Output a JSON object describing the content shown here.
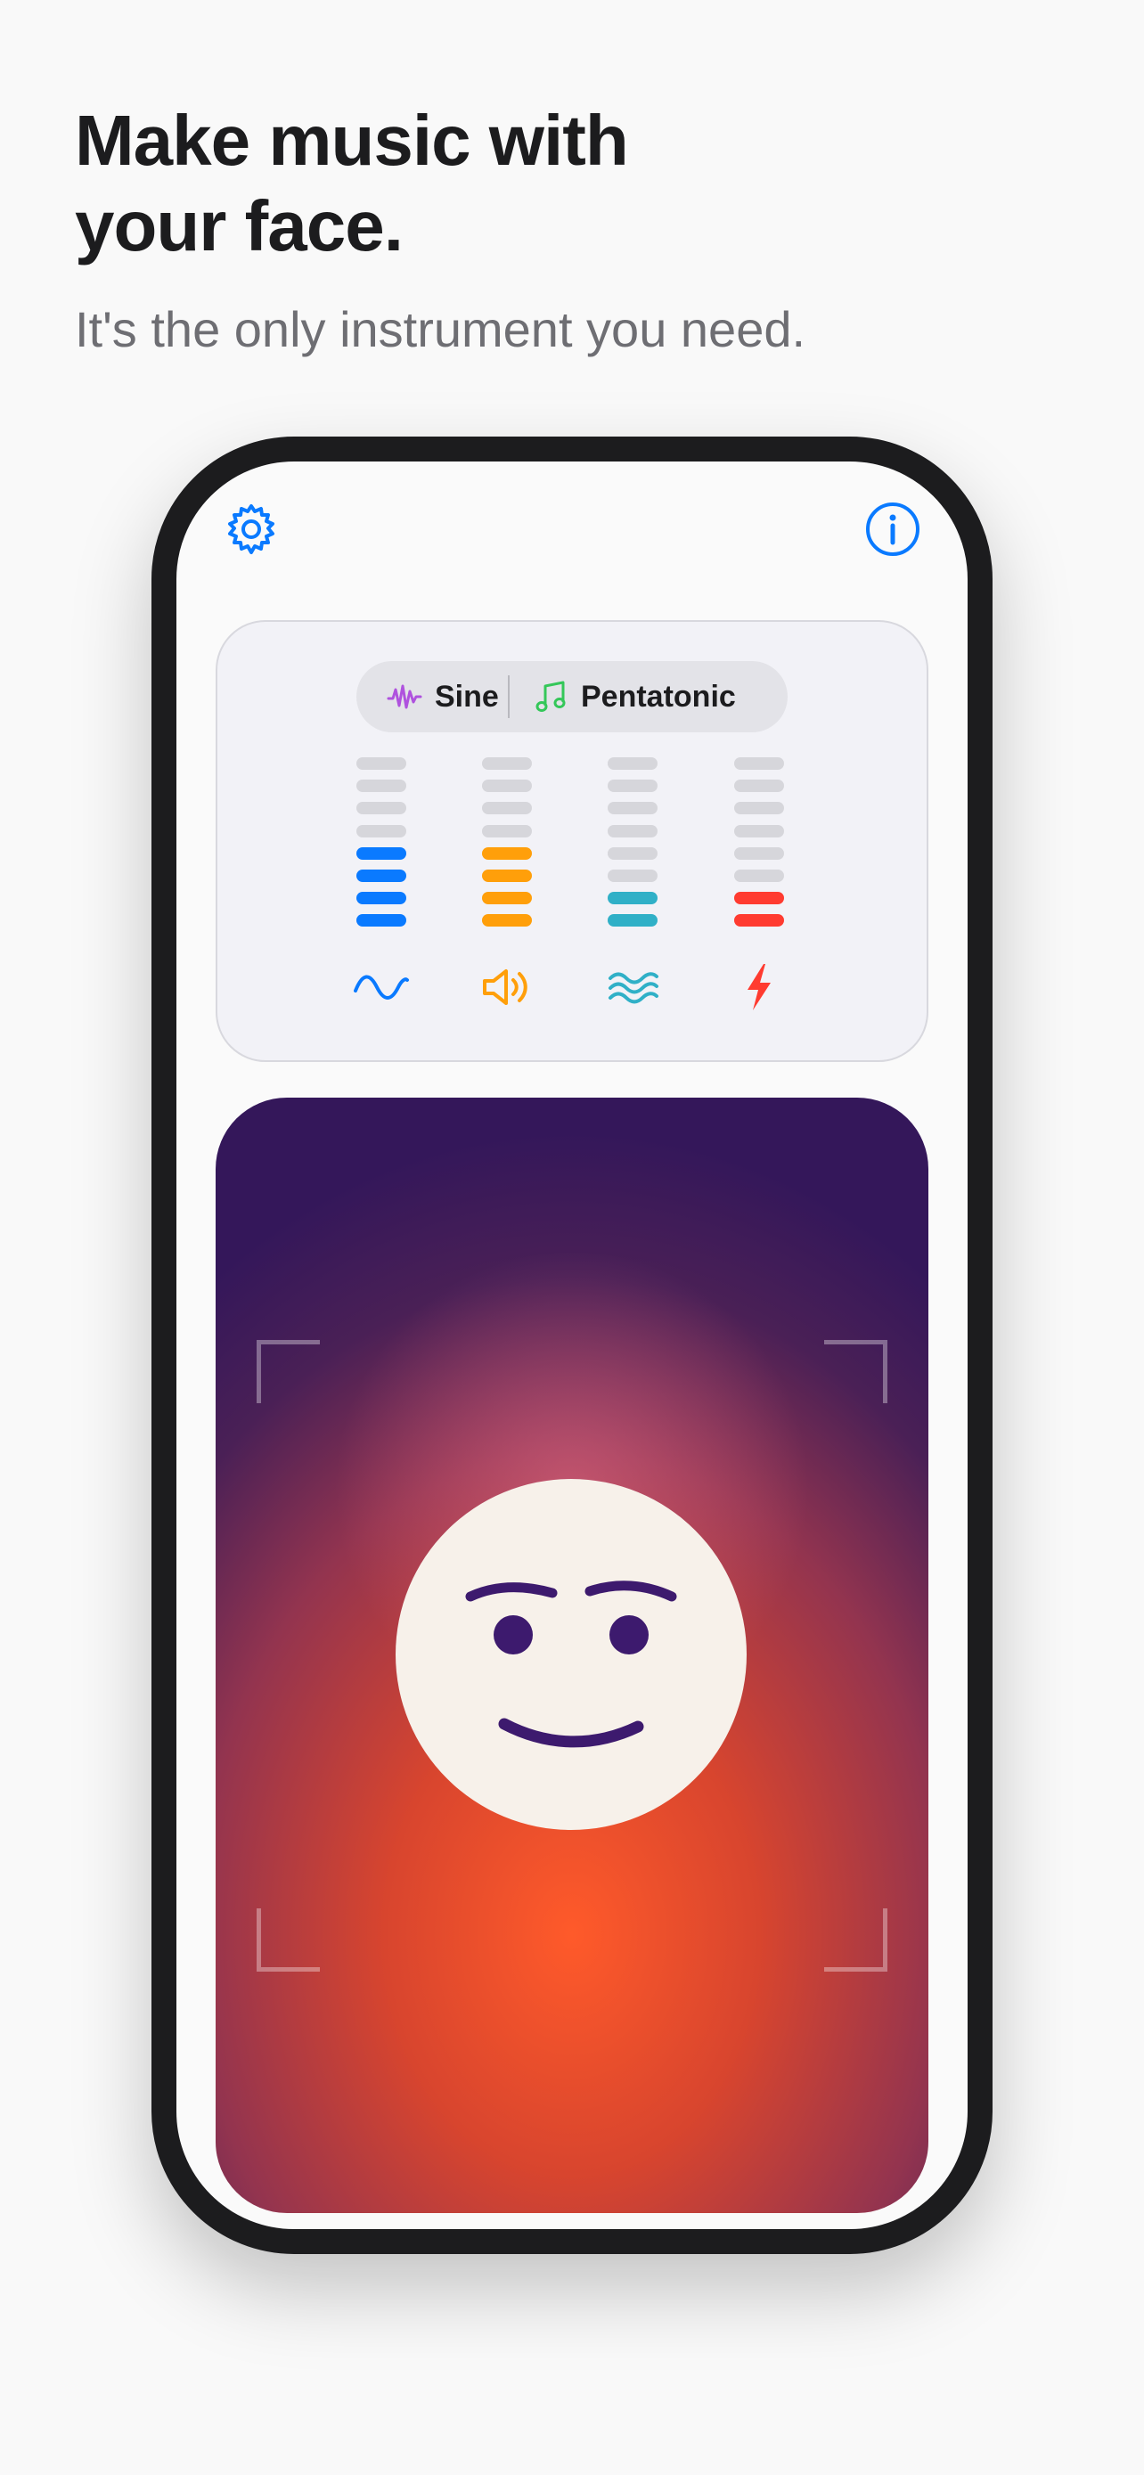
{
  "marketing": {
    "headline_line1": "Make music with",
    "headline_line2": "your face.",
    "subtitle": "It's the only instrument you need."
  },
  "toolbar": {
    "settings_icon": "gear-icon",
    "info_icon": "info-icon"
  },
  "sound_controls": {
    "waveform": {
      "icon": "waveform-icon",
      "label": "Sine",
      "color": "#af52de"
    },
    "scale": {
      "icon": "music-note-icon",
      "label": "Pentatonic",
      "color": "#34c759"
    }
  },
  "meters": [
    {
      "name": "pitch",
      "icon": "sine-wave-icon",
      "level": 4,
      "max": 8,
      "color": "#0a7aff"
    },
    {
      "name": "volume",
      "icon": "speaker-icon",
      "level": 4,
      "max": 8,
      "color": "#ff9f0a"
    },
    {
      "name": "vibrato",
      "icon": "waves-icon",
      "level": 2,
      "max": 8,
      "color": "#30b0c7"
    },
    {
      "name": "distortion",
      "icon": "bolt-icon",
      "level": 2,
      "max": 8,
      "color": "#ff3b30"
    }
  ],
  "camera_view": {
    "face_icon": "face-avatar-icon",
    "face_color": "#f7f1ea",
    "feature_color": "#3d1a6e"
  },
  "colors": {
    "accent": "#0a7aff",
    "inactive_segment": "#d6d6db"
  }
}
